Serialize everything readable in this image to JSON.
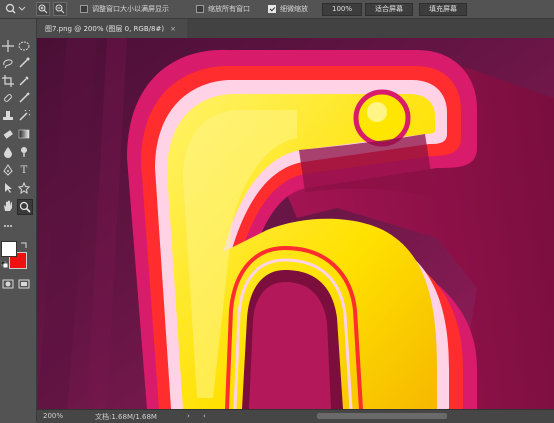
{
  "options_bar": {
    "resize_windows_label": "调整窗口大小以满屏显示",
    "zoom_all_windows_label": "缩放所有窗口",
    "scrubby_zoom_label": "细微缩放",
    "zoom_percent_value": "100%",
    "fit_screen_label": "适合屏幕",
    "fill_screen_label": "填充屏幕",
    "resize_windows_checked": false,
    "zoom_all_windows_checked": false,
    "scrubby_zoom_checked": true
  },
  "tab": {
    "title": "图7.png @ 200% (图层 0, RGB/8#)",
    "close_glyph": "×"
  },
  "status_bar": {
    "zoom": "200%",
    "doc_info": "文档:1.68M/1.68M",
    "arrow_glyph": "›",
    "left_arrow_glyph": "‹"
  },
  "toolbar": {
    "type_tool_glyph": "T"
  },
  "colors": {
    "foreground": "#ffffff",
    "background": "#ee1111"
  }
}
